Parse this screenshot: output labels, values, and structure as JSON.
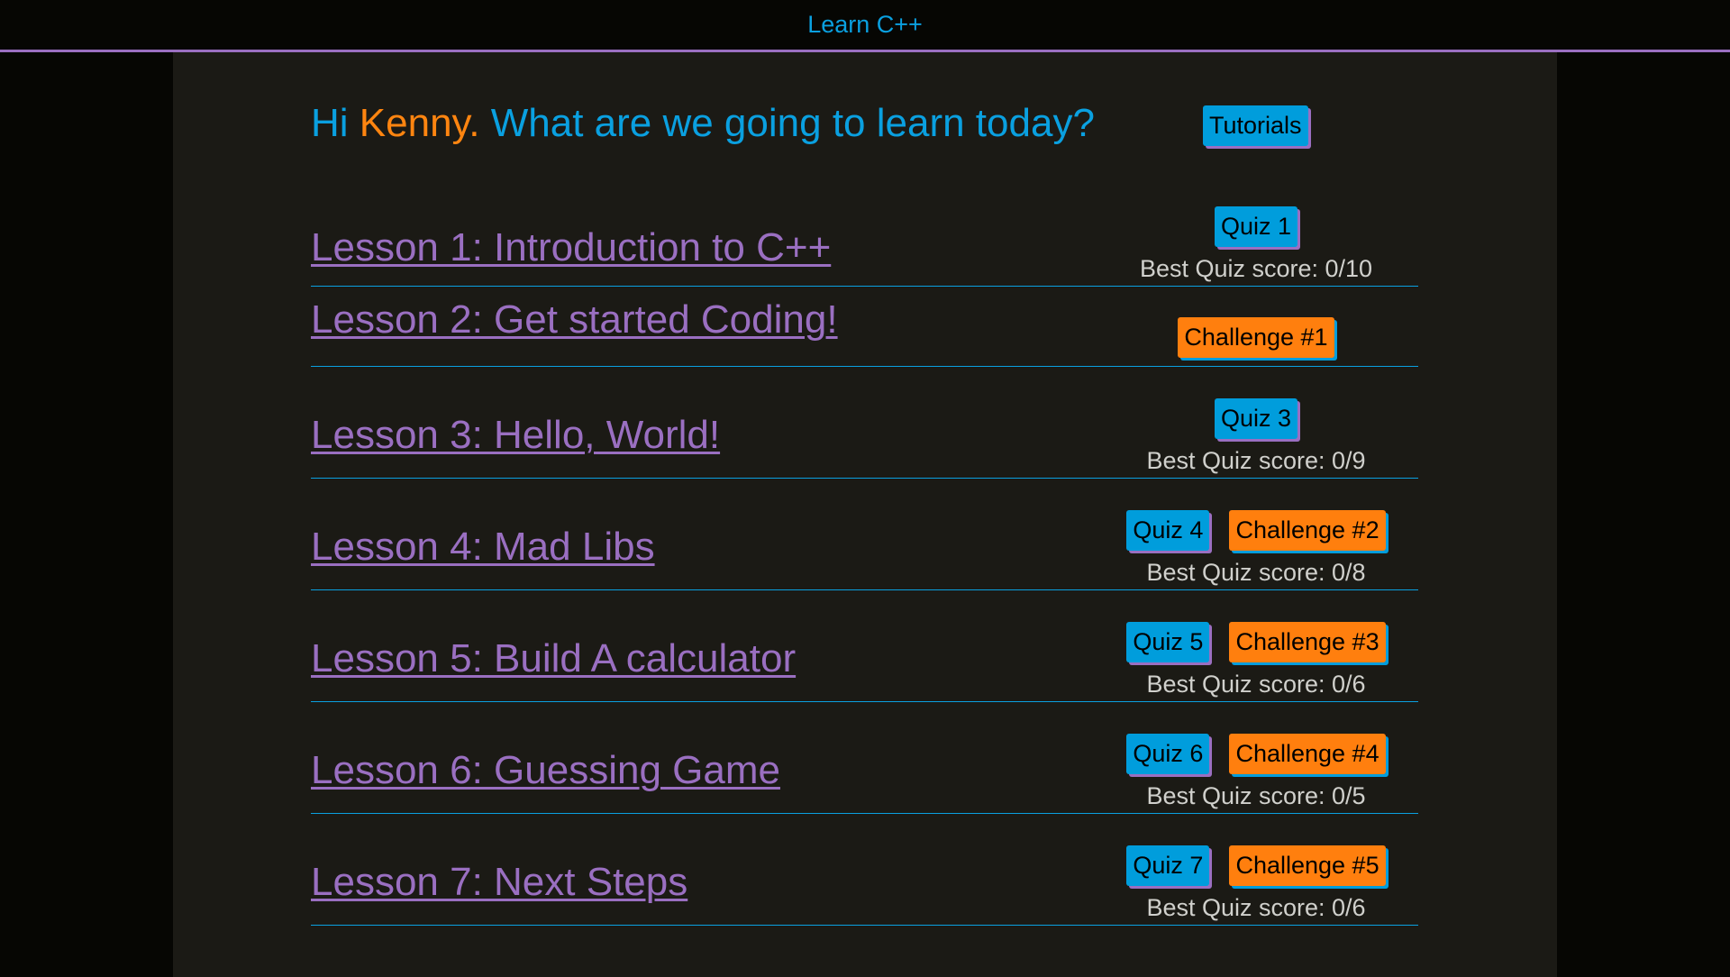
{
  "header": {
    "title": "Learn C++"
  },
  "greeting": {
    "prefix": "Hi ",
    "name": "Kenny.",
    "suffix": " What are we going to learn today?"
  },
  "tutorials_label": "Tutorials",
  "colors": {
    "blue": "#009ddc",
    "orange": "#ff7f0e",
    "purple": "#9a6fc1",
    "panel": "#1b1a15"
  },
  "lessons": [
    {
      "title": "Lesson 1: Introduction to C++",
      "quiz": "Quiz 1",
      "challenge": null,
      "score": "Best Quiz score: 0/10"
    },
    {
      "title": "Lesson 2: Get started Coding!",
      "quiz": null,
      "challenge": "Challenge #1",
      "score": null
    },
    {
      "title": "Lesson 3: Hello, World!",
      "quiz": "Quiz 3",
      "challenge": null,
      "score": "Best Quiz score: 0/9"
    },
    {
      "title": "Lesson 4: Mad Libs",
      "quiz": "Quiz 4",
      "challenge": "Challenge #2",
      "score": "Best Quiz score: 0/8"
    },
    {
      "title": "Lesson 5: Build A calculator",
      "quiz": "Quiz 5",
      "challenge": "Challenge #3",
      "score": "Best Quiz score: 0/6"
    },
    {
      "title": "Lesson 6: Guessing Game",
      "quiz": "Quiz 6",
      "challenge": "Challenge #4",
      "score": "Best Quiz score: 0/5"
    },
    {
      "title": "Lesson 7: Next Steps",
      "quiz": "Quiz 7",
      "challenge": "Challenge #5",
      "score": "Best Quiz score: 0/6"
    }
  ]
}
